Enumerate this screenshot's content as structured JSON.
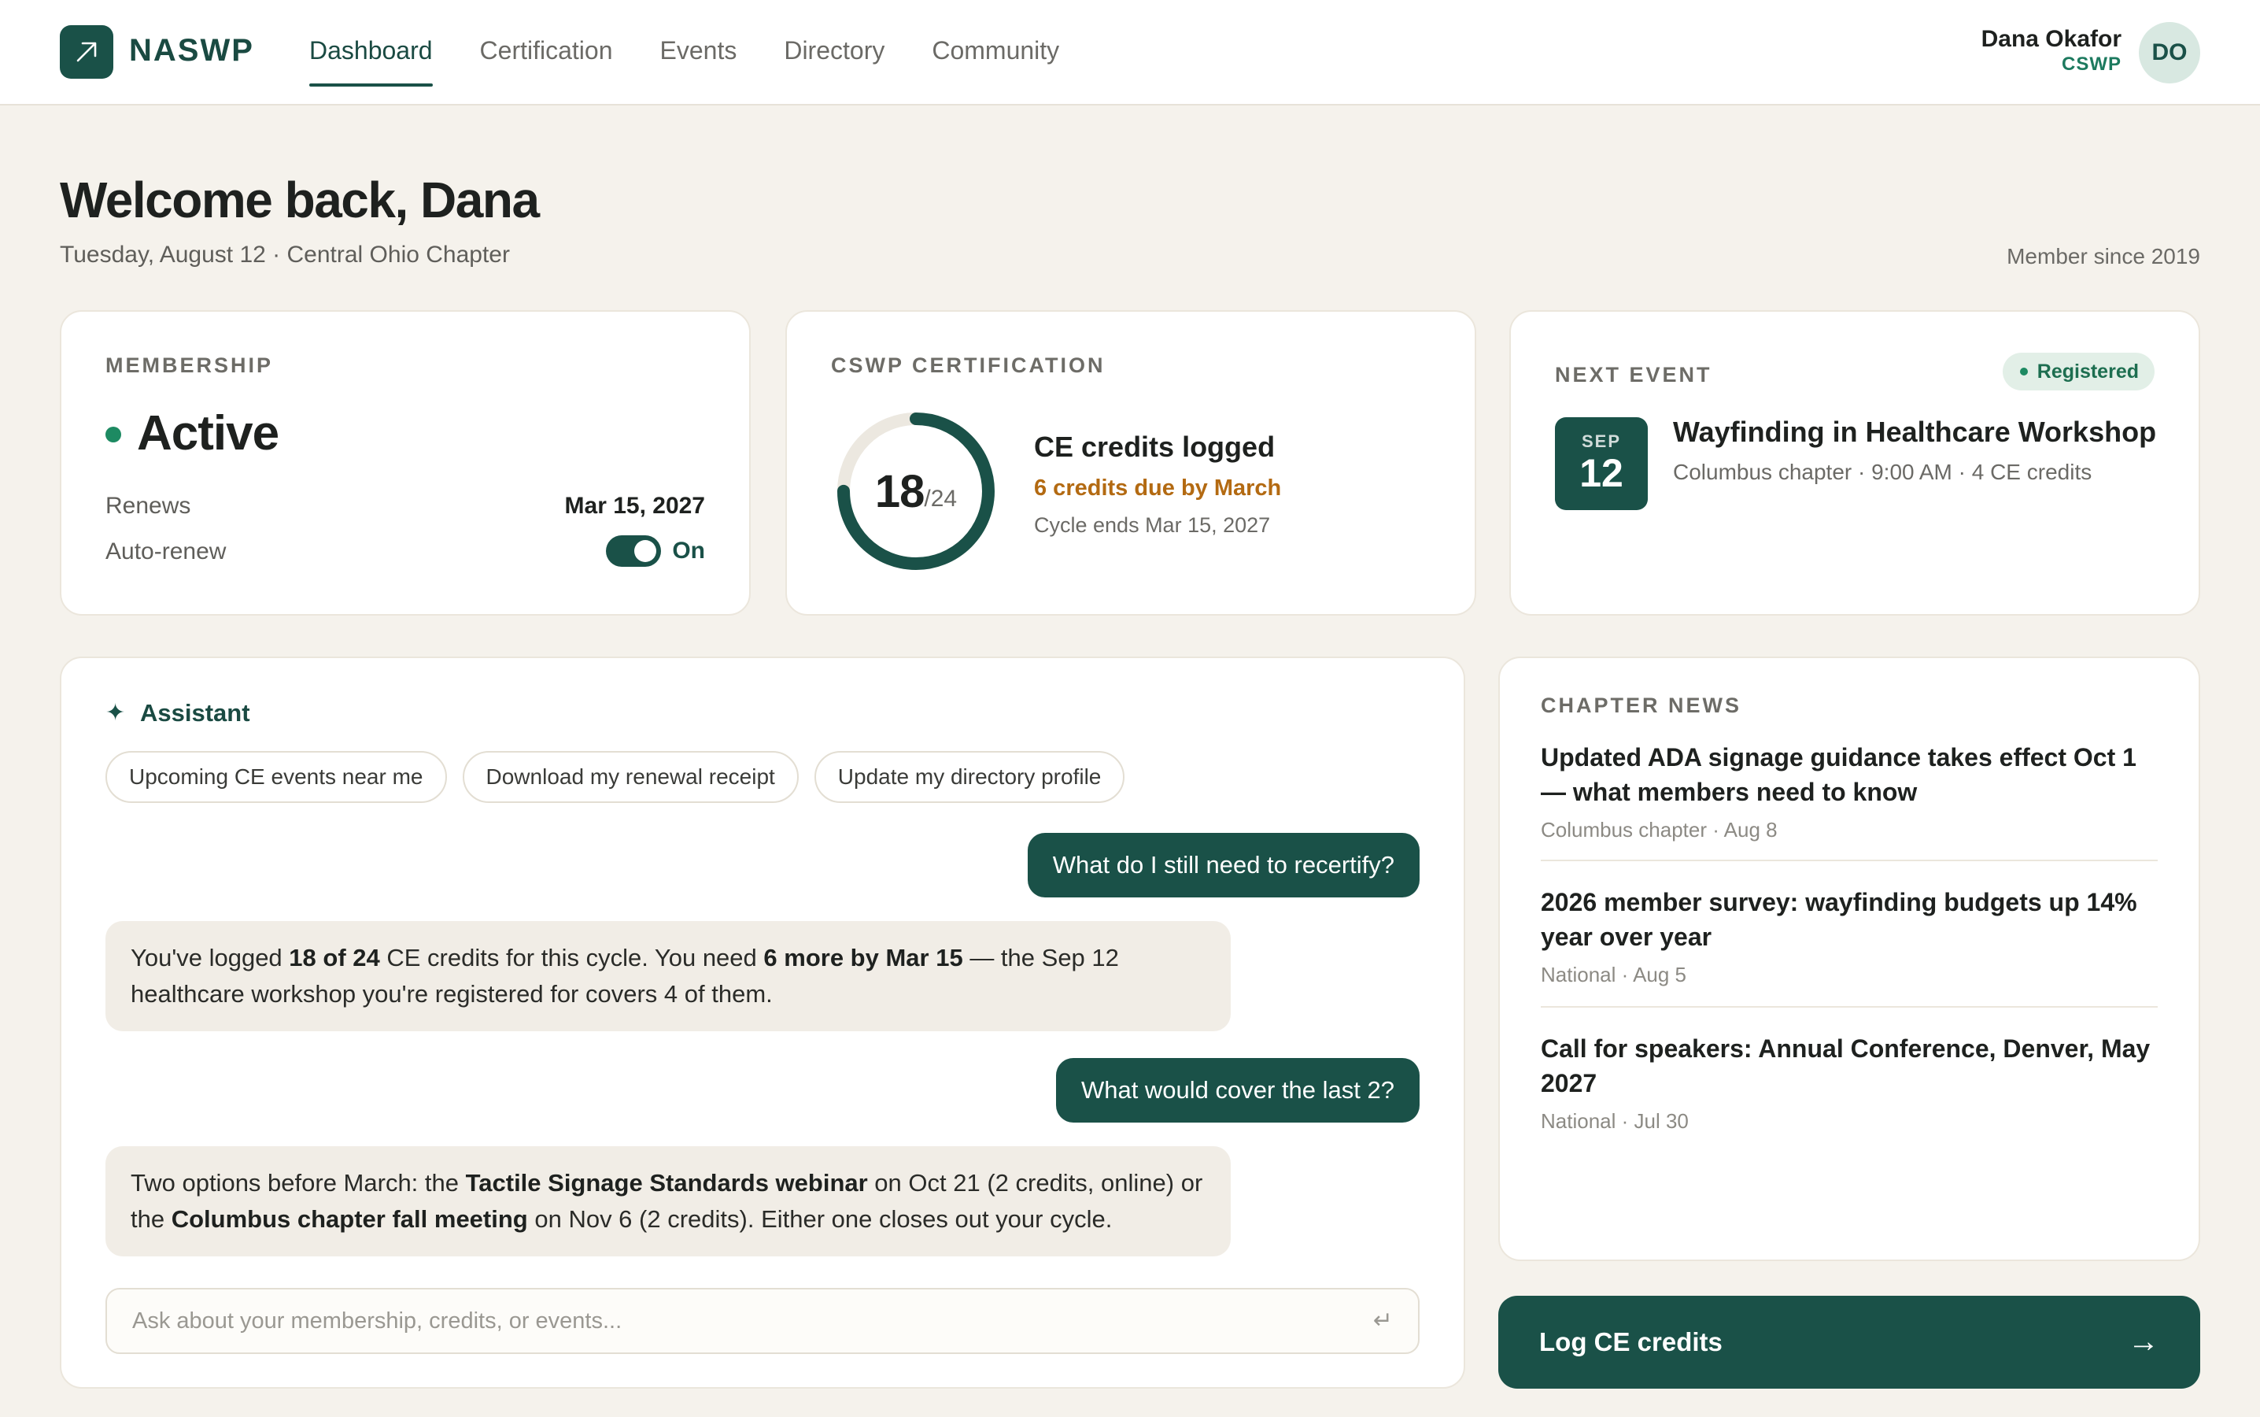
{
  "header": {
    "brand": "NASWP",
    "tabs": [
      {
        "label": "Dashboard"
      },
      {
        "label": "Certification"
      },
      {
        "label": "Events"
      },
      {
        "label": "Directory"
      },
      {
        "label": "Community"
      }
    ],
    "active_tab": "Dashboard",
    "user": {
      "name": "Dana Okafor",
      "role": "CSWP",
      "initials": "DO"
    }
  },
  "welcome": {
    "title": "Welcome back, Dana",
    "subtitle": "Tuesday, August 12 · Central Ohio Chapter",
    "member_since": "Member since 2019"
  },
  "membership": {
    "label": "MEMBERSHIP",
    "status": "Active",
    "renews_label": "Renews",
    "renews_value": "Mar 15, 2027",
    "autorenew_label": "Auto-renew",
    "autorenew_value": "On",
    "autorenew_on": true
  },
  "certification": {
    "label": "CSWP CERTIFICATION",
    "credits_logged": 18,
    "credits_required": 24,
    "credits_logged_text": "18",
    "credits_required_text": "/24",
    "title": "CE credits logged",
    "due": "6 credits due by March",
    "cycle": "Cycle ends Mar 15, 2027",
    "progress_color": "#1a5148",
    "track_color": "#ece8e0"
  },
  "next_event": {
    "label": "NEXT EVENT",
    "badge": "Registered",
    "month": "SEP",
    "day": "12",
    "title": "Wayfinding in Healthcare Workshop",
    "meta": "Columbus chapter · 9:00 AM · 4 CE credits"
  },
  "assistant": {
    "title": "Assistant",
    "chips": [
      {
        "label": "Upcoming CE events near me"
      },
      {
        "label": "Download my renewal receipt"
      },
      {
        "label": "Update my directory profile"
      }
    ],
    "messages": {
      "q1": "What do I still need to recertify?",
      "a1": {
        "t1": "You've logged ",
        "b1": "18 of 24",
        "t2": " CE credits for this cycle. You need ",
        "b2": "6 more by Mar 15",
        "t3": " — the Sep 12 healthcare workshop you're registered for covers 4 of them."
      },
      "q2": "What would cover the last 2?",
      "a2": {
        "t1": "Two options before March: the ",
        "b1": "Tactile Signage Standards webinar",
        "t2": " on Oct 21 (2 credits, online) or the ",
        "b2": "Columbus chapter fall meeting",
        "t3": " on Nov 6 (2 credits). Either one closes out your cycle."
      }
    },
    "input_placeholder": "Ask about your membership, credits, or events...",
    "input_value": ""
  },
  "news": {
    "label": "CHAPTER NEWS",
    "items": [
      {
        "title": "Updated ADA signage guidance takes effect Oct 1 — what members need to know",
        "meta": "Columbus chapter · Aug 8"
      },
      {
        "title": "2026 member survey: wayfinding budgets up 14% year over year",
        "meta": "National · Aug 5"
      },
      {
        "title": "Call for speakers: Annual Conference, Denver, May 2027",
        "meta": "National · Jul 30"
      }
    ]
  },
  "cta": {
    "label": "Log CE credits"
  },
  "colors": {
    "brand": "#1a5148",
    "accent_green": "#1d8a62",
    "warning": "#b36a12",
    "background": "#f5f2ec"
  }
}
